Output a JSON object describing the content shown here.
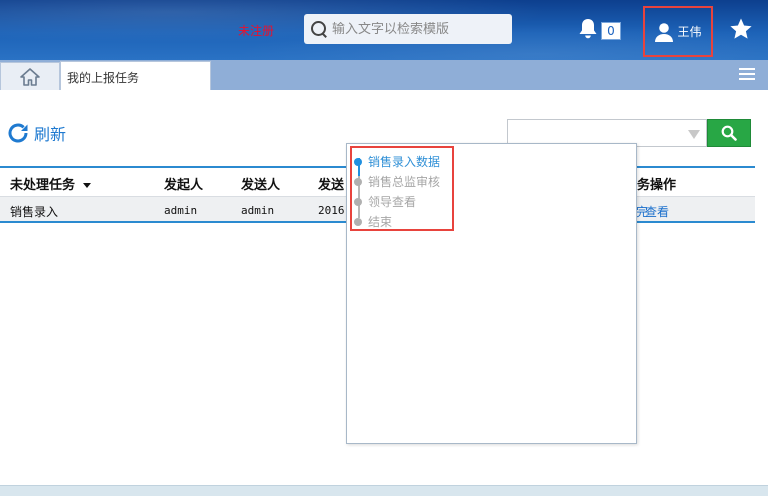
{
  "header": {
    "register_status": "未注册",
    "search_placeholder": "输入文字以检索模版",
    "notification_count": "0",
    "user_name": "王伟"
  },
  "tabs": {
    "home_icon": "home-icon",
    "active_tab_label": "我的上报任务"
  },
  "toolbar": {
    "refresh_label": "刷新",
    "filter_value": ""
  },
  "table": {
    "columns": [
      "未处理任务",
      "发起人",
      "发送人",
      "发送",
      "务操作"
    ],
    "rows": [
      {
        "task": "销售录入",
        "initiator": "admin",
        "sender": "admin",
        "send_time": "2016-",
        "action_prefix": "完",
        "action": "查看"
      }
    ]
  },
  "workflow_popup": {
    "steps": [
      {
        "label": "销售录入数据",
        "active": true
      },
      {
        "label": "销售总监审核",
        "active": false
      },
      {
        "label": "领导查看",
        "active": false
      },
      {
        "label": "结束",
        "active": false
      }
    ]
  },
  "colors": {
    "header_blue": "#1d63b8",
    "accent_blue": "#2b8ad0",
    "search_button_green": "#28a745",
    "highlight_red": "#e8433d",
    "unregistered_red": "#e8112d"
  }
}
